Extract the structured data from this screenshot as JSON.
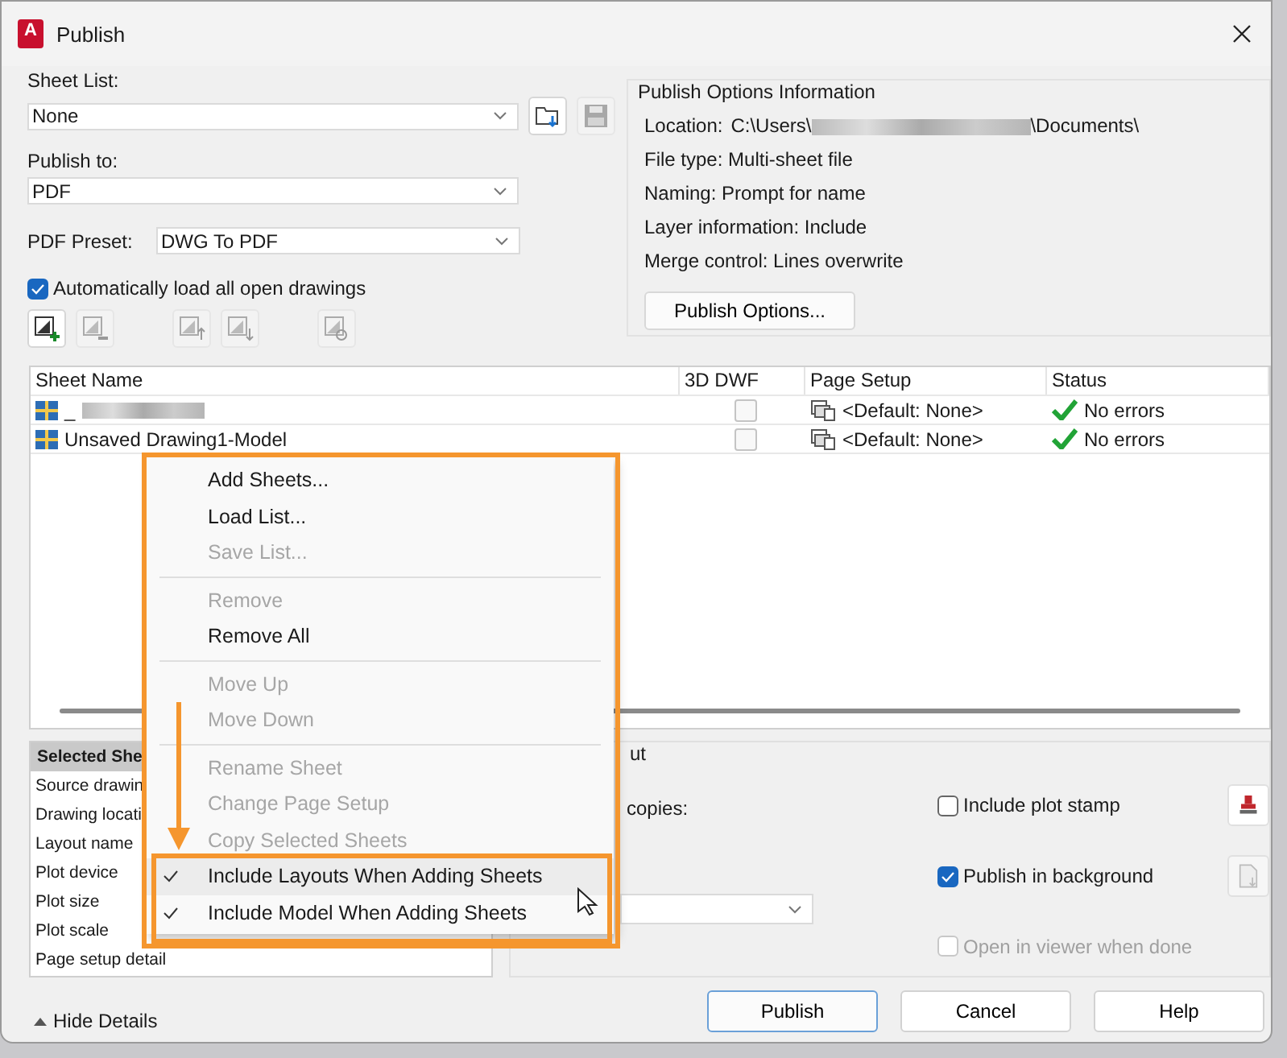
{
  "window": {
    "title": "Publish",
    "icon_text": "A"
  },
  "sheet_list": {
    "label": "Sheet List:",
    "value": "None"
  },
  "publish_to": {
    "label": "Publish to:",
    "value": "PDF"
  },
  "pdf_preset": {
    "label": "PDF Preset:",
    "value": "DWG To PDF"
  },
  "auto_load": {
    "label": "Automatically load all open drawings",
    "checked": true
  },
  "publish_options_info": {
    "title": "Publish Options Information",
    "location": {
      "label": "Location:",
      "prefix": "C:\\Users\\",
      "suffix": "\\Documents\\"
    },
    "lines": [
      {
        "label": "File type:",
        "value": "Multi-sheet file"
      },
      {
        "label": "Naming:",
        "value": "Prompt for name"
      },
      {
        "label": "Layer information:",
        "value": "Include"
      },
      {
        "label": "Merge control:",
        "value": "Lines overwrite"
      }
    ],
    "button": "Publish Options..."
  },
  "table": {
    "columns": [
      "Sheet Name",
      "3D DWF",
      "Page Setup",
      "Status"
    ],
    "rows": [
      {
        "sheet_name": "_",
        "redacted": true,
        "dwf_3d": false,
        "page_setup": "<Default: None>",
        "status": "No errors"
      },
      {
        "sheet_name": "Unsaved Drawing1-Model",
        "redacted": false,
        "dwf_3d": false,
        "page_setup": "<Default: None>",
        "status": "No errors"
      }
    ]
  },
  "selected_sheet_details": {
    "header": "Selected She",
    "rows": [
      "Source drawin",
      "Drawing locati",
      "Layout name",
      "Plot device",
      "Plot size",
      "Plot scale",
      "Page setup detail"
    ]
  },
  "output": {
    "title": "ut",
    "copies_label": "copies:",
    "checkboxes": [
      {
        "label": "Include plot stamp",
        "checked": false,
        "disabled": false
      },
      {
        "label": "Publish in background",
        "checked": true,
        "disabled": false
      },
      {
        "label": "Open in viewer when done",
        "checked": false,
        "disabled": true
      }
    ]
  },
  "hide_details": "Hide Details",
  "buttons": [
    {
      "label": "Publish",
      "default": true
    },
    {
      "label": "Cancel",
      "default": false
    },
    {
      "label": "Help",
      "default": false
    }
  ],
  "context_menu": {
    "items": [
      {
        "kind": "item",
        "label": "Add Sheets...",
        "disabled": false,
        "checked": false,
        "hovered": false
      },
      {
        "kind": "item",
        "label": "Load List...",
        "disabled": false,
        "checked": false,
        "hovered": false
      },
      {
        "kind": "item",
        "label": "Save List...",
        "disabled": true,
        "checked": false,
        "hovered": false
      },
      {
        "kind": "separator"
      },
      {
        "kind": "item",
        "label": "Remove",
        "disabled": true,
        "checked": false,
        "hovered": false
      },
      {
        "kind": "item",
        "label": "Remove All",
        "disabled": false,
        "checked": false,
        "hovered": false
      },
      {
        "kind": "separator"
      },
      {
        "kind": "item",
        "label": "Move Up",
        "disabled": true,
        "checked": false,
        "hovered": false
      },
      {
        "kind": "item",
        "label": "Move Down",
        "disabled": true,
        "checked": false,
        "hovered": false
      },
      {
        "kind": "separator"
      },
      {
        "kind": "item",
        "label": "Rename Sheet",
        "disabled": true,
        "checked": false,
        "hovered": false
      },
      {
        "kind": "item",
        "label": "Change Page Setup",
        "disabled": true,
        "checked": false,
        "hovered": false
      },
      {
        "kind": "item",
        "label": "Copy Selected Sheets",
        "disabled": true,
        "checked": false,
        "hovered": false
      },
      {
        "kind": "item",
        "label": "Include Layouts When Adding Sheets",
        "disabled": false,
        "checked": true,
        "hovered": true
      },
      {
        "kind": "item",
        "label": "Include Model When Adding Sheets",
        "disabled": false,
        "checked": true,
        "hovered": false
      }
    ]
  }
}
